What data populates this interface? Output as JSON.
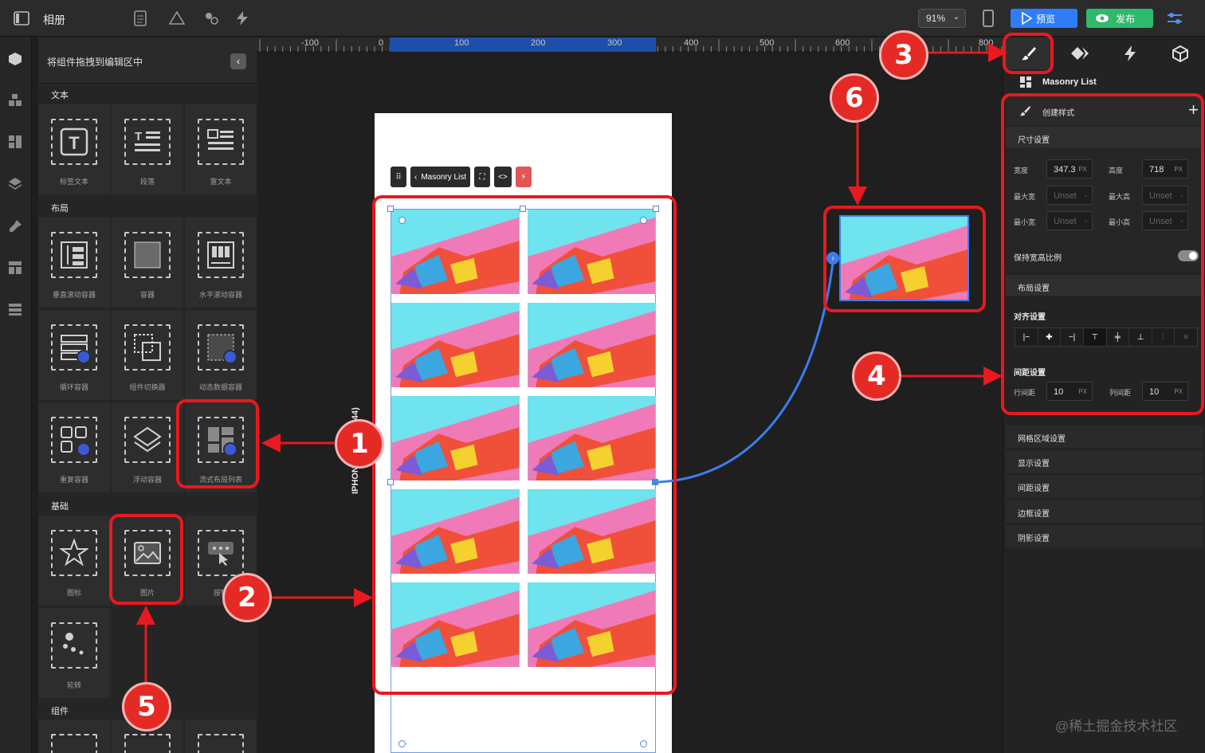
{
  "app": {
    "title": "相册",
    "zoom": "91%",
    "preview_label": "预览",
    "publish_label": "发布",
    "accent_color": "#2f7df6",
    "publish_color": "#2fb96b"
  },
  "left_panel": {
    "hint": "将组件拖拽到编辑区中",
    "sections": {
      "text": "文本",
      "layout": "布局",
      "basic": "基础",
      "components": "组件"
    },
    "text_items": [
      "标签文本",
      "段落",
      "富文本"
    ],
    "layout_items": [
      "垂直滚动容器",
      "容器",
      "水平滚动容器",
      "循环容器",
      "组件切换器",
      "动态数据容器",
      "重复容器",
      "浮动容器",
      "流式布局列表"
    ],
    "basic_items": [
      "图标",
      "图片",
      "按钮",
      "轮转"
    ]
  },
  "ruler": {
    "labels": [
      "-100",
      "0",
      "100",
      "200",
      "300",
      "400",
      "500",
      "600",
      "800"
    ]
  },
  "canvas": {
    "device_label": "IPHONE 12 (390*844)",
    "toolbar_label": "Masonry List"
  },
  "right_panel": {
    "component_name": "Masonry List",
    "create_style": "创建样式",
    "size_section": "尺寸设置",
    "width_label": "宽度",
    "width_value": "347.3",
    "height_label": "高度",
    "height_value": "718",
    "unit": "PX",
    "max_width_label": "最大宽",
    "max_height_label": "最大高",
    "min_width_label": "最小宽",
    "min_height_label": "最小高",
    "unset": "Unset",
    "dash": "-",
    "keep_ratio": "保持宽高比例",
    "layout_section": "布局设置",
    "align_section": "对齐设置",
    "spacing_section": "间距设置",
    "row_gap_label": "行间距",
    "row_gap_value": "10",
    "col_gap_label": "列间距",
    "col_gap_value": "10",
    "collapsed": [
      "网格区域设置",
      "显示设置",
      "间距设置",
      "边框设置",
      "阴影设置"
    ]
  },
  "annotations": {
    "badges": [
      "1",
      "2",
      "3",
      "4",
      "5",
      "6"
    ],
    "color": "#e8191f"
  },
  "watermark": "@稀土掘金技术社区"
}
